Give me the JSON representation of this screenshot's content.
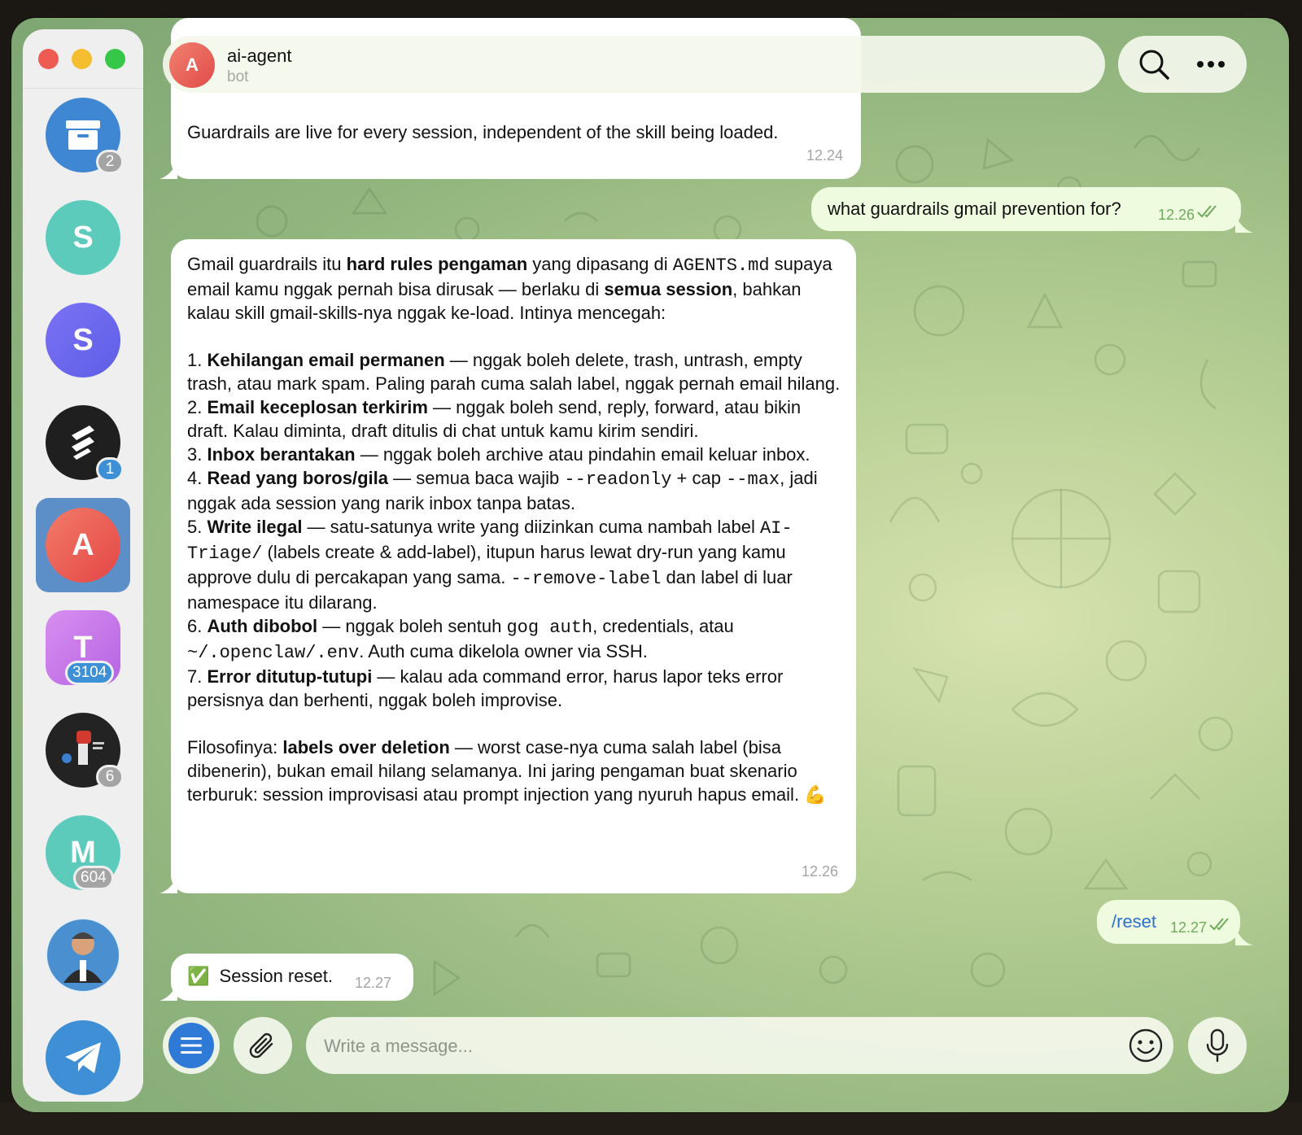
{
  "window": {
    "header": {
      "avatar_letter": "A",
      "title": "ai-agent",
      "subtitle": "bot"
    },
    "sidebar": {
      "chats": [
        {
          "label": "",
          "badge": "2",
          "color": "#3f86d3",
          "icon": "archive-icon"
        },
        {
          "label": "S",
          "badge": "",
          "color": "#5ccbbc"
        },
        {
          "label": "S",
          "badge": "",
          "color": "#6a6cf0"
        },
        {
          "label": "",
          "badge": "1",
          "color": "#1f1f1f",
          "icon": "stripe-logo-icon"
        },
        {
          "label": "A",
          "badge": "",
          "color": "#e95050",
          "active": true
        },
        {
          "label": "T",
          "badge": "3104",
          "color": "#c47be8"
        },
        {
          "label": "",
          "badge": "6",
          "color": "#232323",
          "icon": "fist-poster-avatar"
        },
        {
          "label": "M",
          "badge": "604",
          "color": "#5ccbbc"
        },
        {
          "label": "",
          "badge": "",
          "color": "#4a8fd0",
          "icon": "cartoon-man-avatar"
        },
        {
          "label": "",
          "badge": "",
          "color": "#3f8fd6",
          "icon": "telegram-icon"
        }
      ]
    },
    "messages": {
      "m1": {
        "text": "Guardrails are live for every session, independent of the skill being loaded.",
        "time": "12.24"
      },
      "m2": {
        "text": "what guardrails gmail prevention for?",
        "time": "12.26"
      },
      "m3": {
        "time": "12.26",
        "intro": {
          "a": "Gmail guardrails itu ",
          "b": "hard rules pengaman",
          "c": " yang dipasang di ",
          "d": "AGENTS.md",
          "e": " supaya email kamu nggak pernah bisa dirusak — berlaku di ",
          "f": "semua session",
          "g": ", bahkan kalau skill gmail-skills-nya nggak ke-load. Intinya mencegah:"
        },
        "items": [
          {
            "num": "1. ",
            "title": "Kehilangan email permanen",
            "rest": " — nggak boleh delete, trash, untrash, empty trash, atau mark spam. Paling parah cuma salah label, nggak pernah email hilang."
          },
          {
            "num": "2. ",
            "title": "Email keceplosan terkirim",
            "rest": " — nggak boleh send, reply, forward, atau bikin draft. Kalau diminta, draft ditulis di chat untuk kamu kirim sendiri."
          },
          {
            "num": "3. ",
            "title": "Inbox berantakan",
            "rest": " — nggak boleh archive atau pindahin email keluar inbox."
          },
          {
            "num": "4. ",
            "title": "Read yang boros/gila",
            "p1": " — semua baca wajib ",
            "c1": "--readonly",
            "p2": " + cap ",
            "c2": "--max",
            "p3": ", jadi nggak ada session yang narik inbox tanpa batas."
          },
          {
            "num": "5. ",
            "title": "Write ilegal",
            "p1": " — satu-satunya write yang diizinkan cuma nambah label ",
            "c1": "AI-Triage/",
            "p2": " (labels create & add-label), itupun harus lewat dry-run yang kamu approve dulu di percakapan yang sama. ",
            "c2": "--remove-label",
            "p3": " dan label di luar namespace itu dilarang."
          },
          {
            "num": "6. ",
            "title": "Auth dibobol",
            "p1": " — nggak boleh sentuh ",
            "c1": "gog auth",
            "p2": ", credentials, atau ",
            "c2": "~/.openclaw/.env",
            "p3": ". Auth cuma dikelola owner via SSH."
          },
          {
            "num": "7. ",
            "title": "Error ditutup-tutupi",
            "rest": " — kalau ada command error, harus lapor teks error persisnya dan berhenti, nggak boleh improvise."
          }
        ],
        "outro": {
          "a": "Filosofinya: ",
          "b": "labels over deletion",
          "c": " — worst case-nya cuma salah label (bisa dibenerin), bukan email hilang selamanya. Ini jaring pengaman buat skenario terburuk: session improvisasi atau prompt injection yang nyuruh hapus email. 💪"
        }
      },
      "m4": {
        "text": "/reset",
        "time": "12.27"
      },
      "m5": {
        "emoji": "✅",
        "text": "Session reset.",
        "time": "12.27"
      }
    },
    "composer": {
      "placeholder": "Write a message..."
    }
  }
}
